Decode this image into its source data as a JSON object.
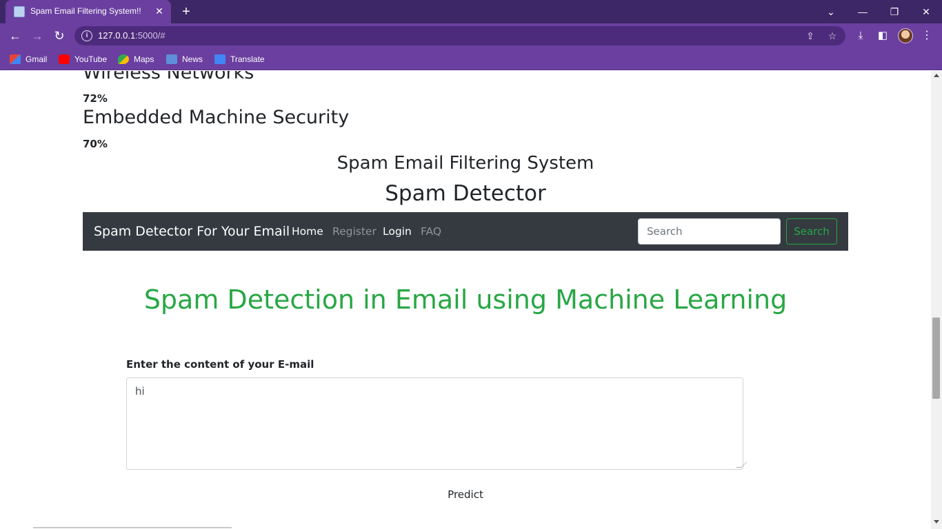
{
  "browser": {
    "tab_title": "Spam Email Filtering System!!",
    "url_host": "127.0.0.1",
    "url_rest": ":5000/#",
    "bookmarks": [
      "Gmail",
      "YouTube",
      "Maps",
      "News",
      "Translate"
    ]
  },
  "courses": [
    {
      "title": "Wireless Networks",
      "percent": "72%"
    },
    {
      "title": "Embedded Machine Security",
      "percent": "70%"
    }
  ],
  "headings": {
    "system_title": "Spam Email Filtering System",
    "detector_title": "Spam Detector"
  },
  "navbar": {
    "brand": "Spam Detector For Your Email",
    "links": [
      "Home",
      "Register",
      "Login",
      "FAQ"
    ],
    "search_placeholder": "Search",
    "search_button": "Search"
  },
  "main": {
    "hero_title": "Spam Detection in Email using Machine Learning",
    "email_label": "Enter the content of your E-mail",
    "email_value": "hi",
    "predict_label": "Predict"
  },
  "colors": {
    "chrome_purple": "#6a3fa0",
    "navbar_dark": "#343a40",
    "success_green": "#28a745"
  }
}
